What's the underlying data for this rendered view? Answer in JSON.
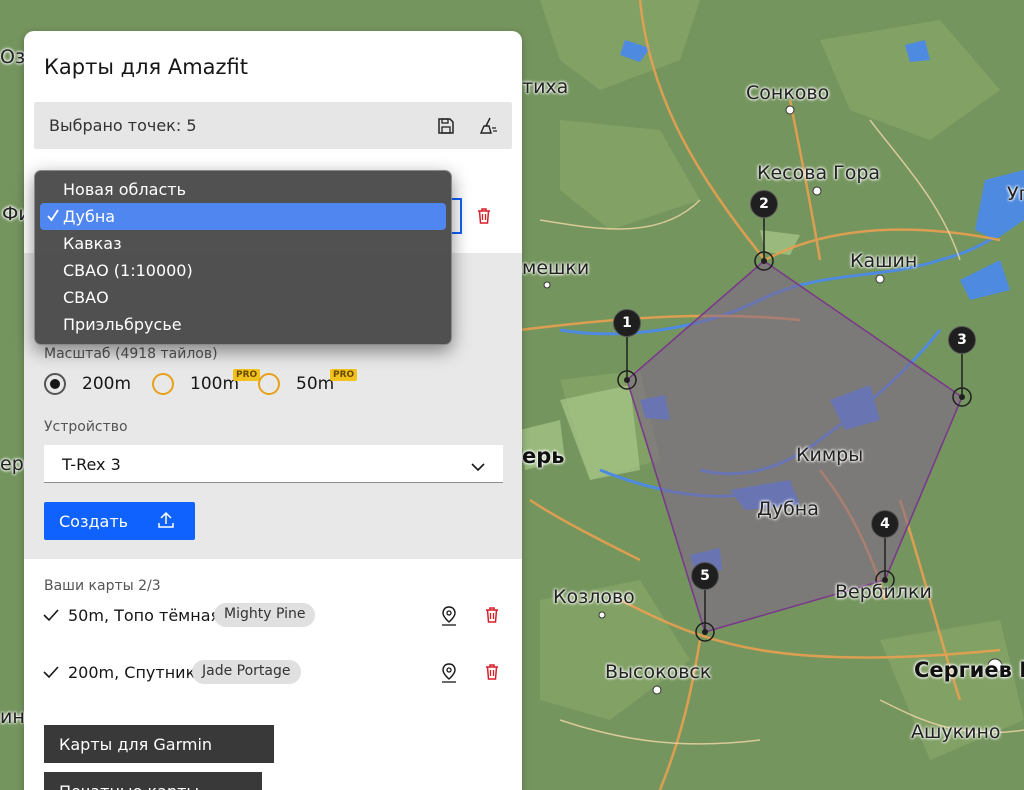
{
  "map": {
    "places": [
      {
        "name": "Сонково"
      },
      {
        "name": "Кесова Гора"
      },
      {
        "name": "Кашин"
      },
      {
        "name": "Кимры"
      },
      {
        "name": "Дубна"
      },
      {
        "name": "Вербилки"
      },
      {
        "name": "Козлово"
      },
      {
        "name": "Высоковск"
      },
      {
        "name": "Сергиев П"
      },
      {
        "name": "Ашукино"
      },
      {
        "name": "тиха"
      },
      {
        "name": "мешки"
      },
      {
        "name": "ерь"
      },
      {
        "name": "Озе"
      },
      {
        "name": "Фи"
      },
      {
        "name": "еро"
      },
      {
        "name": "ин"
      },
      {
        "name": "Уг"
      }
    ],
    "markers": [
      "1",
      "2",
      "3",
      "4",
      "5"
    ],
    "polygon_color": "#7a3a8a"
  },
  "panel": {
    "title": "Карты для Amazfit",
    "points_selected": "Выбрано точек: 5",
    "save_icon": "save-icon",
    "clear_icon": "broom-icon",
    "scale_label": "Масштаб (4918 тайлов)",
    "scale_options": [
      {
        "label": "200m",
        "checked": true,
        "pro": false
      },
      {
        "label": "100m",
        "checked": false,
        "pro": true
      },
      {
        "label": "50m",
        "checked": false,
        "pro": true
      }
    ],
    "pro_badge": "PRO",
    "device_label": "Устройство",
    "device_value": "T-Rex 3",
    "create_button": "Создать",
    "your_maps_title": "Ваши карты 2/3",
    "maps": [
      {
        "name": "50m, Топо тёмная",
        "tag": "Mighty Pine"
      },
      {
        "name": "200m, Спутник",
        "tag": "Jade Portage"
      }
    ],
    "garmin_button": "Карты для Garmin",
    "print_button": "Печатные карты"
  },
  "dropdown": {
    "items": [
      "Новая область",
      "Дубна",
      "Кавказ",
      "СВАО (1:10000)",
      "СВАО",
      "Приэльбрусье"
    ],
    "selected": "Дубна"
  },
  "colors": {
    "accent": "#0f62fe",
    "danger": "#da1e28",
    "pro": "#f1c21b",
    "dropdown_selected": "#4f86f0"
  }
}
